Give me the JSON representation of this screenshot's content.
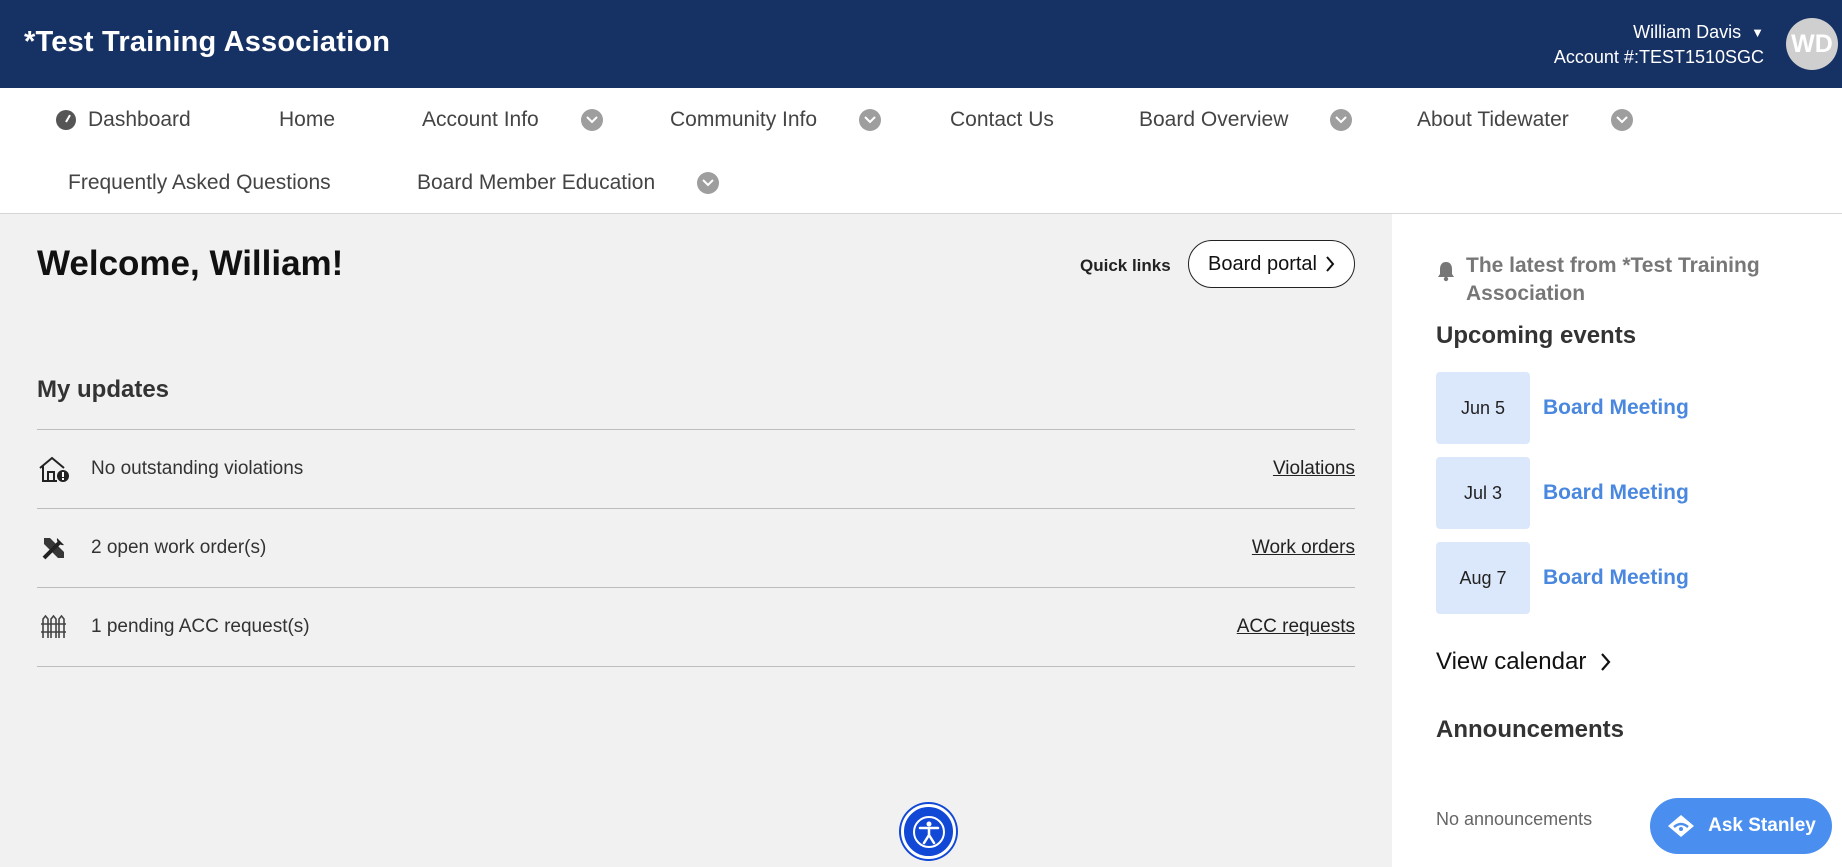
{
  "header": {
    "brand": "*Test Training Association",
    "user_name": "William Davis",
    "account": "Account #:TEST1510SGC",
    "avatar_initials": "WD"
  },
  "nav": {
    "dashboard": "Dashboard",
    "home": "Home",
    "account_info": "Account Info",
    "community_info": "Community Info",
    "contact_us": "Contact Us",
    "board_overview": "Board Overview",
    "about_tidewater": "About Tidewater",
    "faq": "Frequently Asked Questions",
    "board_member_education": "Board Member Education"
  },
  "main": {
    "welcome": "Welcome, William!",
    "quick_links_label": "Quick links",
    "board_portal": "Board portal",
    "updates_title": "My updates",
    "updates": [
      {
        "icon": "house-alert-icon",
        "text": "No outstanding violations",
        "link": "Violations"
      },
      {
        "icon": "tools-icon",
        "text": "2 open work order(s)",
        "link": "Work orders"
      },
      {
        "icon": "fence-icon",
        "text": "1 pending ACC request(s)",
        "link": "ACC requests"
      }
    ]
  },
  "sidebar": {
    "latest": "The latest from *Test Training Association",
    "upcoming_title": "Upcoming events",
    "events": [
      {
        "date": "Jun 5",
        "name": "Board Meeting"
      },
      {
        "date": "Jul 3",
        "name": "Board Meeting"
      },
      {
        "date": "Aug 7",
        "name": "Board Meeting"
      }
    ],
    "view_calendar": "View calendar",
    "announcements_title": "Announcements",
    "no_announcements": "No announcements"
  },
  "chat": {
    "label": "Ask Stanley"
  },
  "colors": {
    "header_bg": "#163163",
    "accent": "#4a8ff0",
    "link_blue": "#4a88e0",
    "date_bg": "#dbe7fa"
  }
}
